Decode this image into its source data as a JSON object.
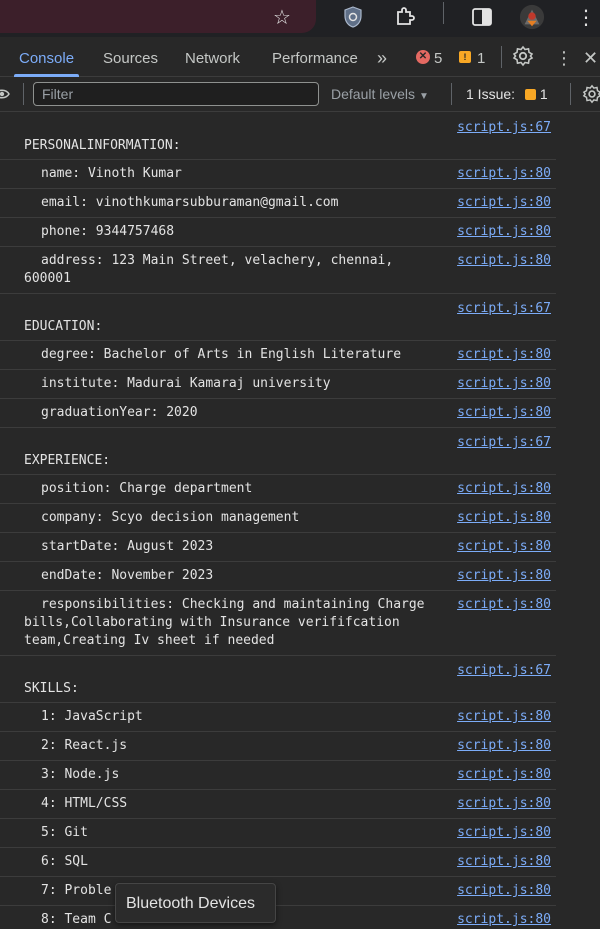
{
  "browser": {
    "icons": [
      "star-icon",
      "vpn-icon",
      "extensions-icon",
      "sidepanel-icon",
      "profile-avatar-icon",
      "more-vert-icon"
    ]
  },
  "devtools": {
    "tabs": [
      "Console",
      "Sources",
      "Network",
      "Performance"
    ],
    "active_tab": "Console",
    "errors_count": "5",
    "warnings_count": "1"
  },
  "toolbar": {
    "filter_placeholder": "Filter",
    "levels_label": "Default levels",
    "issues_label": "1 Issue:",
    "issues_count": "1"
  },
  "console": {
    "group_location": "script.js:67",
    "item_location": "script.js:80",
    "groups": [
      {
        "title": "PERSONALINFORMATION:",
        "items": [
          "name: Vinoth Kumar",
          "email: vinothkumarsubburaman@gmail.com",
          "phone: 9344757468",
          "address: 123 Main Street, velachery, chennai, 600001"
        ]
      },
      {
        "title": "EDUCATION:",
        "items": [
          "degree: Bachelor of Arts in English Literature",
          "institute: Madurai Kamaraj university",
          "graduationYear: 2020"
        ]
      },
      {
        "title": "EXPERIENCE:",
        "items": [
          "position: Charge department",
          "company: Scyo decision management",
          "startDate: August 2023",
          "endDate: November 2023",
          "responsibilities: Checking and maintaining Charge bills,Collaborating with Insurance verififcation team,Creating Iv sheet if needed"
        ]
      },
      {
        "title": "SKILLS:",
        "items": [
          "1: JavaScript",
          "2: React.js",
          "3: Node.js",
          "4: HTML/CSS",
          "5: Git",
          "6: SQL",
          "7: Proble",
          "8: Team C"
        ]
      }
    ]
  },
  "tooltip": {
    "text": "Bluetooth Devices"
  }
}
